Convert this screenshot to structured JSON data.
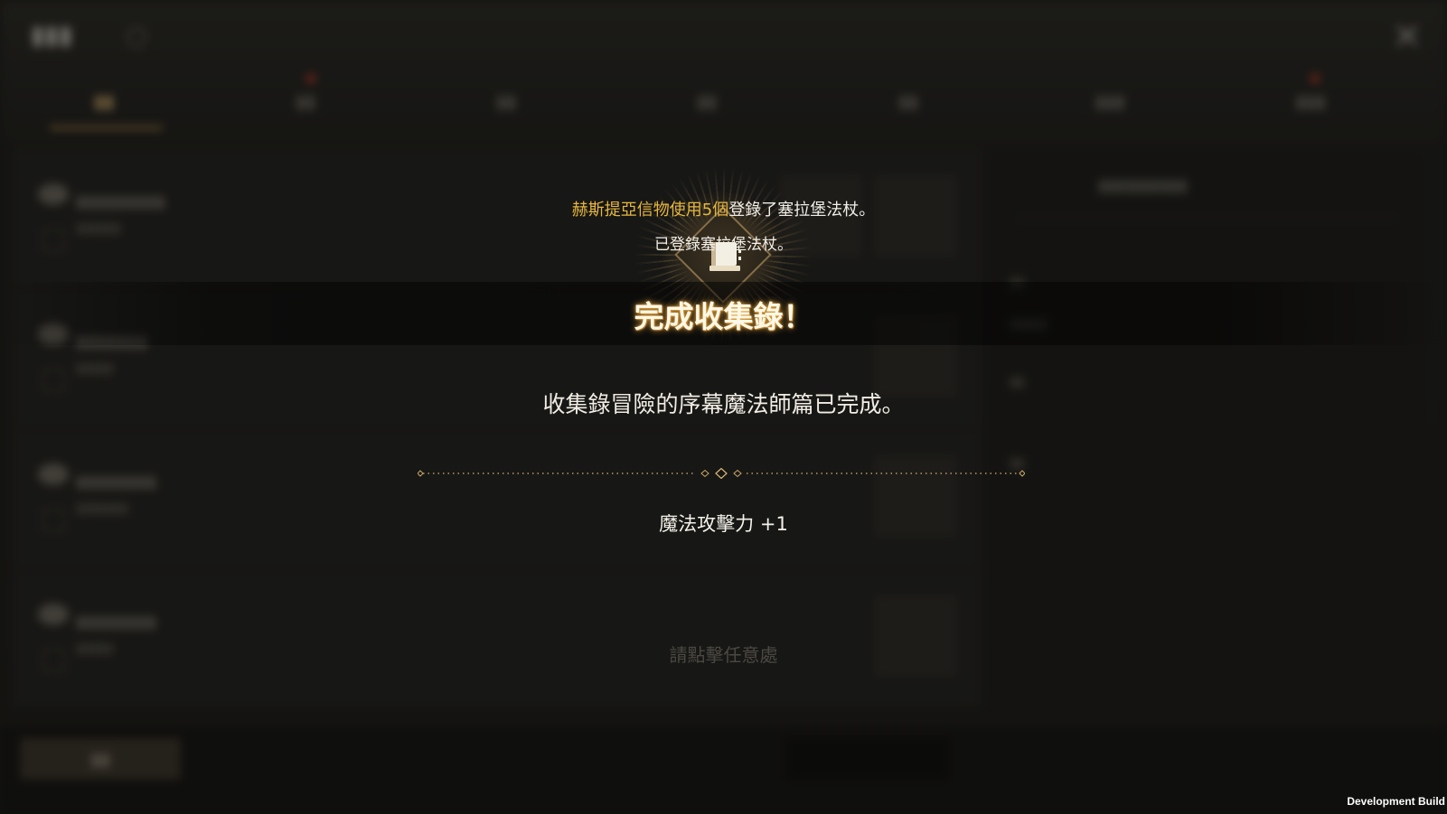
{
  "popup": {
    "notice_highlight": "赫斯提亞信物使用5個",
    "notice_rest": "登錄了塞拉堡法杖。",
    "sub_notice": "已登錄塞拉堡法杖。",
    "title": "完成收集錄！",
    "message": "收集錄冒險的序幕魔法師篇已完成。",
    "reward": "魔法攻擊力 +1",
    "tap_hint": "請點擊任意處"
  },
  "footer": {
    "build_label": "Development Build"
  },
  "colors": {
    "highlight": "#e6b63e",
    "title_glow": "#e6aa46"
  },
  "icons": {
    "emblem": "book-icon",
    "close": "close-icon"
  }
}
